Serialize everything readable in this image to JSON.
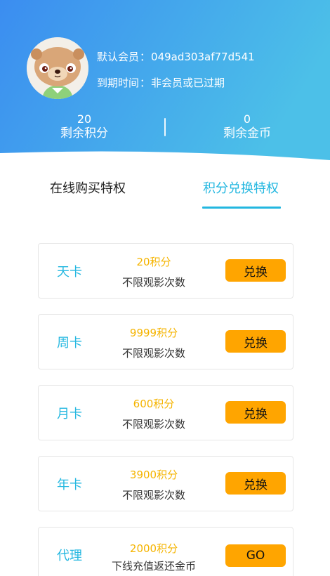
{
  "colors": {
    "header_gradient_start": "#3b8df0",
    "header_gradient_end": "#4cc0e8",
    "accent": "#23b7e0",
    "points_color": "#f5b400",
    "button": "#ffa500"
  },
  "header": {
    "member_label": "默认会员",
    "member_id": "049ad303af77d541",
    "expiry_label": "到期时间",
    "expiry_value": "非会员或已过期",
    "separator": "："
  },
  "stats": {
    "points_value": "20",
    "points_label": "剩余积分",
    "coins_value": "0",
    "coins_label": "剩余金币"
  },
  "tabs": [
    {
      "label": "在线购买特权",
      "active": false
    },
    {
      "label": "积分兑换特权",
      "active": true
    }
  ],
  "cards": [
    {
      "name": "天卡",
      "points": "20积分",
      "desc": "不限观影次数",
      "button": "兑换"
    },
    {
      "name": "周卡",
      "points": "9999积分",
      "desc": "不限观影次数",
      "button": "兑换"
    },
    {
      "name": "月卡",
      "points": "600积分",
      "desc": "不限观影次数",
      "button": "兑换"
    },
    {
      "name": "年卡",
      "points": "3900积分",
      "desc": "不限观影次数",
      "button": "兑换"
    },
    {
      "name": "代理",
      "points": "2000积分",
      "desc": "下线充值返还金币",
      "button": "GO"
    }
  ]
}
